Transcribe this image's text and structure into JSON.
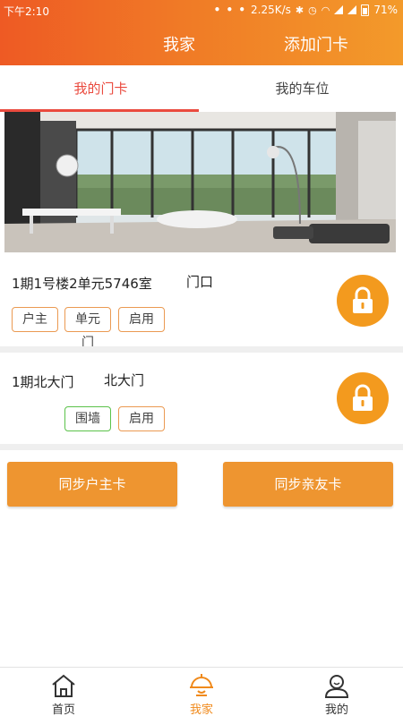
{
  "status_bar": {
    "time": "下午2:10",
    "dots": "• • •",
    "net_speed": "2.25K/s",
    "battery": "71%"
  },
  "header": {
    "title": "我家",
    "add_card": "添加门卡"
  },
  "tabs": [
    {
      "label": "我的门卡",
      "active": true
    },
    {
      "label": "我的车位",
      "active": false
    }
  ],
  "cards": [
    {
      "address": "1期1号楼2单元5746室",
      "gate": "门口",
      "badges": [
        "户主",
        "单元门",
        "启用"
      ],
      "lock_icon": "padlock-icon"
    },
    {
      "address": "1期北大门",
      "gate": "北大门",
      "badges": [
        "围墙",
        "启用"
      ],
      "lock_icon": "padlock-icon"
    }
  ],
  "buttons": {
    "sync_owner": "同步户主卡",
    "sync_family": "同步亲友卡"
  },
  "bottom_nav": [
    {
      "label": "首页",
      "icon": "home-icon",
      "active": false
    },
    {
      "label": "我家",
      "icon": "lamp-icon",
      "active": true
    },
    {
      "label": "我的",
      "icon": "person-icon",
      "active": false
    }
  ],
  "colors": {
    "header_start": "#ee5a24",
    "header_end": "#f39a2a",
    "accent": "#f08a1c",
    "tab_active": "#ea4a3e",
    "badge_orange": "#eb9a52",
    "badge_green": "#5bc24a"
  }
}
